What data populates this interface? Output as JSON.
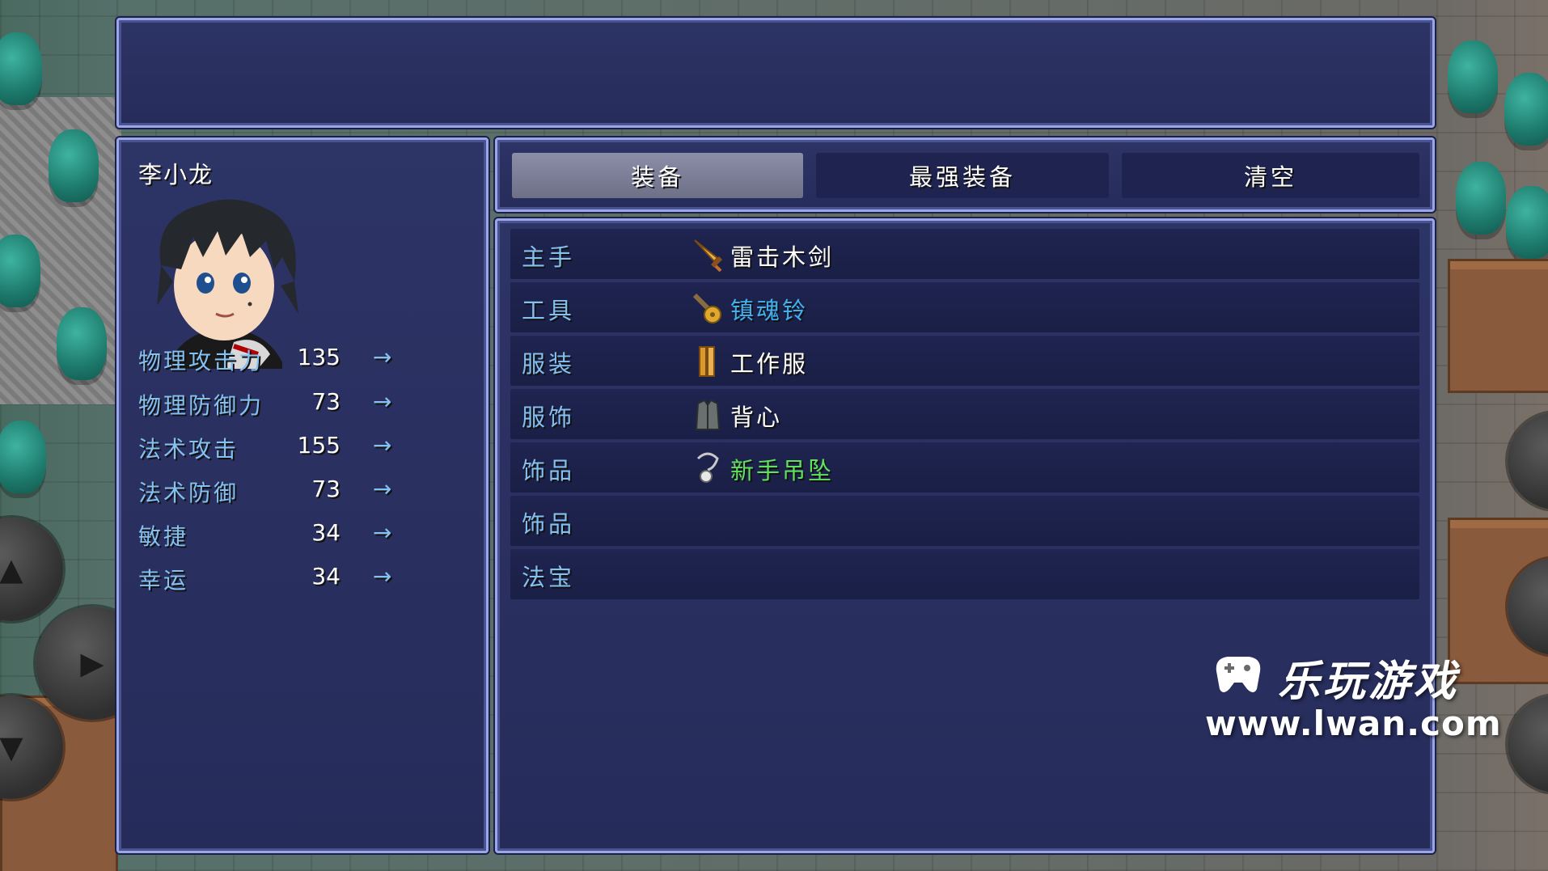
{
  "help": {
    "text": ""
  },
  "actor": {
    "name": "李小龙",
    "params": [
      {
        "label": "物理攻击力",
        "value": "135",
        "arrow": "→"
      },
      {
        "label": "物理防御力",
        "value": "73",
        "arrow": "→"
      },
      {
        "label": "法术攻击",
        "value": "155",
        "arrow": "→"
      },
      {
        "label": "法术防御",
        "value": "73",
        "arrow": "→"
      },
      {
        "label": "敏捷",
        "value": "34",
        "arrow": "→"
      },
      {
        "label": "幸运",
        "value": "34",
        "arrow": "→"
      }
    ]
  },
  "commands": [
    {
      "label": "装备",
      "selected": true
    },
    {
      "label": "最强装备",
      "selected": false
    },
    {
      "label": "清空",
      "selected": false
    }
  ],
  "slots": [
    {
      "type": "主手",
      "item": "雷击木剑",
      "item_color": "#ffffff",
      "icon": "wooden-sword-icon"
    },
    {
      "type": "工具",
      "item": "镇魂铃",
      "item_color": "#40b0f0",
      "icon": "bell-icon"
    },
    {
      "type": "服装",
      "item": "工作服",
      "item_color": "#ffffff",
      "icon": "clothes-icon"
    },
    {
      "type": "服饰",
      "item": "背心",
      "item_color": "#ffffff",
      "icon": "vest-icon"
    },
    {
      "type": "饰品",
      "item": "新手吊坠",
      "item_color": "#60e060",
      "icon": "pendant-icon"
    },
    {
      "type": "饰品",
      "item": "",
      "item_color": "#ffffff",
      "icon": ""
    },
    {
      "type": "法宝",
      "item": "",
      "item_color": "#ffffff",
      "icon": ""
    }
  ],
  "watermark": {
    "title": "乐玩游戏",
    "url": "www.lwan.com"
  },
  "colors": {
    "window_bg": "#2a3060",
    "system_blue": "#84c0f0",
    "border": "#9aa6ea"
  }
}
